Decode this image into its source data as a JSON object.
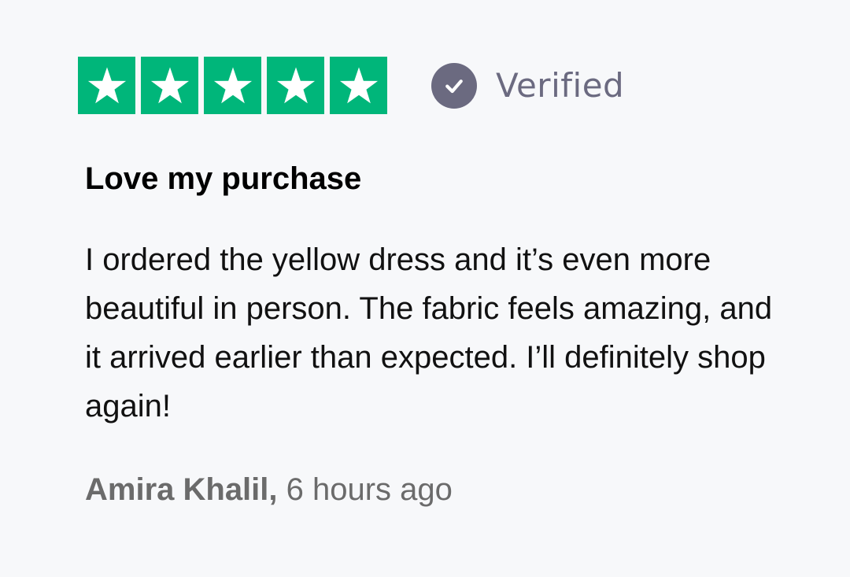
{
  "rating": {
    "stars": 5,
    "max_stars": 5,
    "star_color": "#00b67a",
    "icon": "star-icon"
  },
  "verified": {
    "label": "Verified",
    "icon": "check-circle-icon",
    "color": "#6b6a80"
  },
  "review": {
    "title": "Love my purchase",
    "body": "I ordered the yellow dress and it’s even more beautiful in person. The fabric feels amazing, and it arrived earlier than expected. I’ll definitely shop again!",
    "author": "Amira Khalil,",
    "time_ago": "6 hours ago"
  }
}
